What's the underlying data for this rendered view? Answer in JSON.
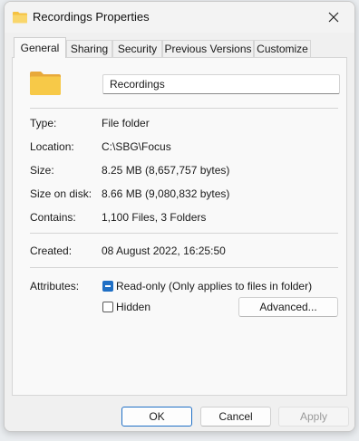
{
  "window": {
    "title": "Recordings Properties"
  },
  "tabs": [
    {
      "label": "General",
      "active": true
    },
    {
      "label": "Sharing",
      "active": false
    },
    {
      "label": "Security",
      "active": false
    },
    {
      "label": "Previous Versions",
      "active": false
    },
    {
      "label": "Customize",
      "active": false
    }
  ],
  "general": {
    "folder_name": "Recordings",
    "fields": [
      {
        "label": "Type:",
        "value": "File folder"
      },
      {
        "label": "Location:",
        "value": "C:\\SBG\\Focus"
      },
      {
        "label": "Size:",
        "value": "8.25 MB (8,657,757 bytes)"
      },
      {
        "label": "Size on disk:",
        "value": "8.66 MB (9,080,832 bytes)"
      },
      {
        "label": "Contains:",
        "value": "1,100 Files, 3 Folders"
      }
    ],
    "created": {
      "label": "Created:",
      "value": "08 August 2022, 16:25:50"
    },
    "attributes": {
      "label": "Attributes:",
      "readonly_label": "Read-only (Only applies to files in folder)",
      "readonly_state": "indeterminate",
      "hidden_label": "Hidden",
      "hidden_checked": false,
      "advanced_label": "Advanced..."
    }
  },
  "buttons": {
    "ok": "OK",
    "cancel": "Cancel",
    "apply": "Apply"
  },
  "colors": {
    "accent": "#1f6fc5",
    "folder": "#f5c242"
  },
  "icons": {
    "title": "folder-icon",
    "close": "close-icon",
    "main": "folder-icon"
  }
}
